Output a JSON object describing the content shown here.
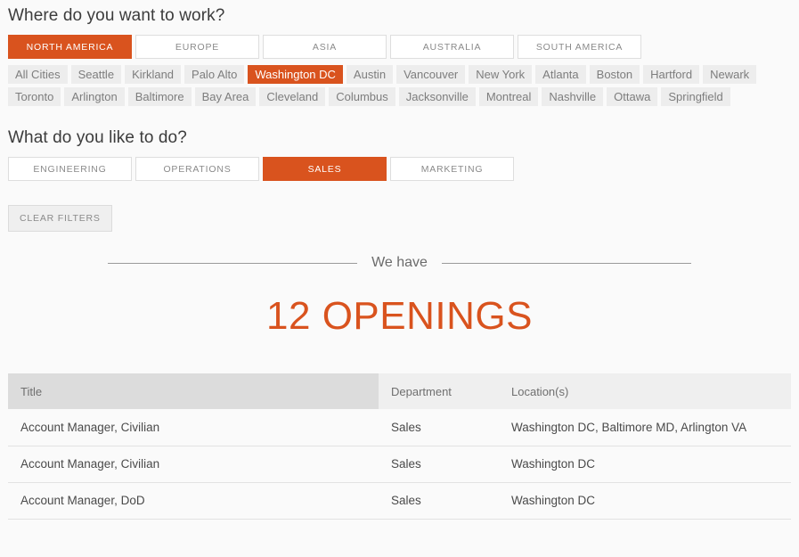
{
  "sections": {
    "where": {
      "heading": "Where do you want to work?",
      "regions": [
        {
          "label": "NORTH AMERICA",
          "active": true
        },
        {
          "label": "EUROPE",
          "active": false
        },
        {
          "label": "ASIA",
          "active": false
        },
        {
          "label": "AUSTRALIA",
          "active": false
        },
        {
          "label": "SOUTH AMERICA",
          "active": false
        }
      ],
      "cities": [
        {
          "label": "All Cities",
          "active": false
        },
        {
          "label": "Seattle",
          "active": false
        },
        {
          "label": "Kirkland",
          "active": false
        },
        {
          "label": "Palo Alto",
          "active": false
        },
        {
          "label": "Washington DC",
          "active": true
        },
        {
          "label": "Austin",
          "active": false
        },
        {
          "label": "Vancouver",
          "active": false
        },
        {
          "label": "New York",
          "active": false
        },
        {
          "label": "Atlanta",
          "active": false
        },
        {
          "label": "Boston",
          "active": false
        },
        {
          "label": "Hartford",
          "active": false
        },
        {
          "label": "Newark",
          "active": false
        },
        {
          "label": "Toronto",
          "active": false
        },
        {
          "label": "Arlington",
          "active": false
        },
        {
          "label": "Baltimore",
          "active": false
        },
        {
          "label": "Bay Area",
          "active": false
        },
        {
          "label": "Cleveland",
          "active": false
        },
        {
          "label": "Columbus",
          "active": false
        },
        {
          "label": "Jacksonville",
          "active": false
        },
        {
          "label": "Montreal",
          "active": false
        },
        {
          "label": "Nashville",
          "active": false
        },
        {
          "label": "Ottawa",
          "active": false
        },
        {
          "label": "Springfield",
          "active": false
        }
      ]
    },
    "what": {
      "heading": "What do you like to do?",
      "departments": [
        {
          "label": "ENGINEERING",
          "active": false
        },
        {
          "label": "OPERATIONS",
          "active": false
        },
        {
          "label": "SALES",
          "active": true
        },
        {
          "label": "MARKETING",
          "active": false
        }
      ]
    },
    "clear_filters_label": "CLEAR FILTERS"
  },
  "results": {
    "we_have_label": "We have",
    "openings_label": "12 OPENINGS",
    "columns": [
      "Title",
      "Department",
      "Location(s)"
    ],
    "rows": [
      {
        "title": "Account Manager, Civilian",
        "department": "Sales",
        "locations": "Washington DC, Baltimore MD, Arlington VA"
      },
      {
        "title": "Account Manager, Civilian",
        "department": "Sales",
        "locations": "Washington DC"
      },
      {
        "title": "Account Manager, DoD",
        "department": "Sales",
        "locations": "Washington DC"
      }
    ]
  },
  "colors": {
    "accent": "#d9531e",
    "page_background": "#fafafa",
    "chip_background": "#ededed",
    "header_title_background": "#dcdcdc",
    "header_other_background": "#efefef"
  }
}
